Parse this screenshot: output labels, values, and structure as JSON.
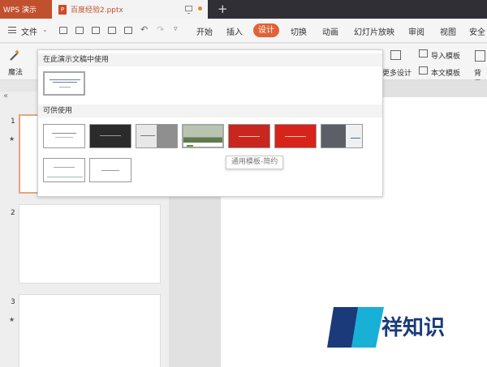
{
  "titlebar": {
    "app_name": "WPS 演示",
    "document_name": "百度经验2.pptx",
    "doc_icon_letter": "P"
  },
  "menubar": {
    "file_label": "文件",
    "tabs": [
      "开始",
      "插入",
      "设计",
      "切换",
      "动画",
      "幻灯片放映",
      "审阅",
      "视图",
      "安全"
    ],
    "active_tab": "设计"
  },
  "ribbon": {
    "magic_label": "魔法",
    "more_design_label": "更多设计",
    "import_template_label": "导入模板",
    "this_doc_template_label": "本文模板",
    "background_label": "背景"
  },
  "template_panel": {
    "in_use_header": "在此演示文稿中使用",
    "available_header": "可供使用",
    "tooltip": "通用模板-简约"
  },
  "slides": [
    {
      "number": "1"
    },
    {
      "number": "2"
    },
    {
      "number": "3"
    }
  ],
  "watermark": {
    "text": "祥知识"
  },
  "colors": {
    "accent": "#e06236",
    "app_tab": "#c1502e",
    "titlebar": "#2f2f35",
    "watermark_blue": "#1a3a7a",
    "watermark_cyan": "#19b0d8"
  }
}
